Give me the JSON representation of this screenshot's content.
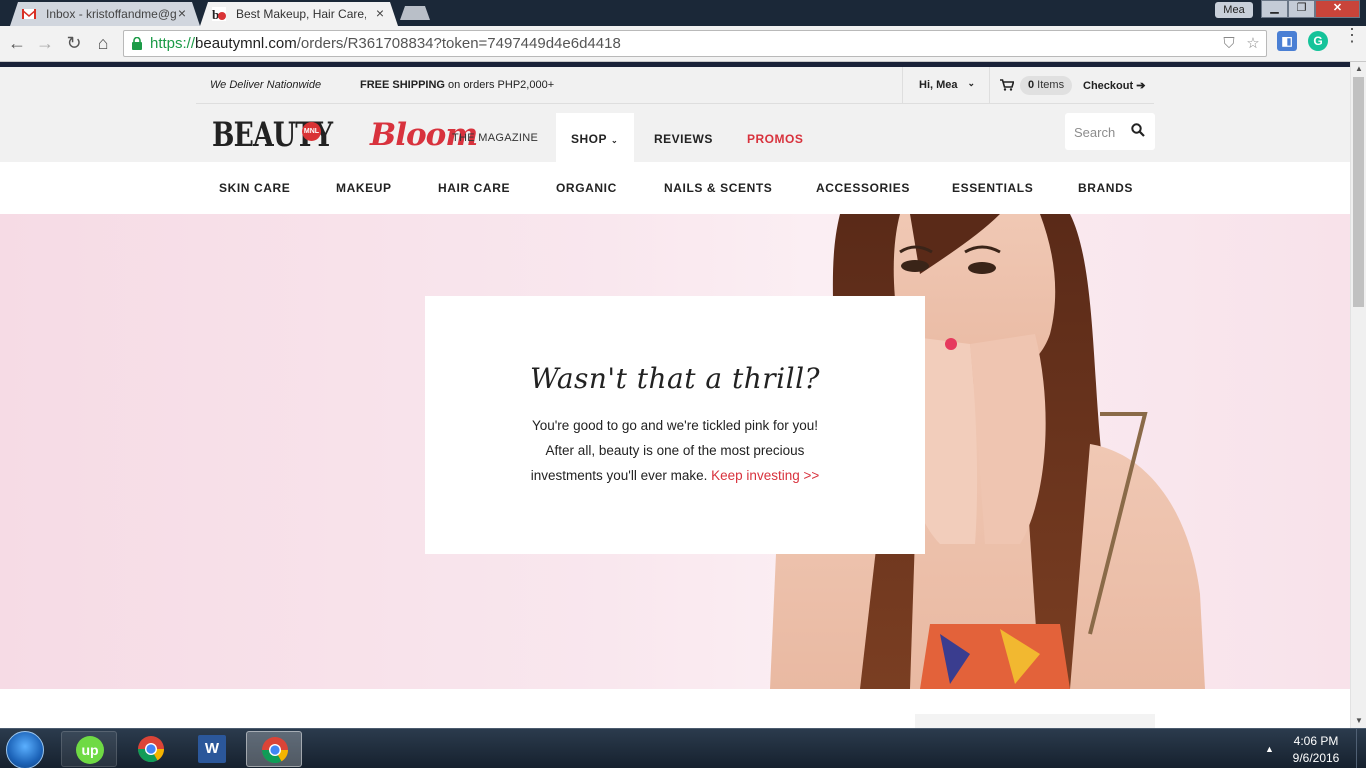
{
  "browser": {
    "tabs": [
      {
        "title": "Inbox - kristoffandme@gr",
        "active": false,
        "icon": "gmail-icon"
      },
      {
        "title": "Best Makeup, Hair Care, S",
        "active": true,
        "icon": "beautymnl-favicon"
      }
    ],
    "profile_name": "Mea",
    "url_scheme": "https://",
    "url_host": "beautymnl.com",
    "url_path": "/orders/R361708834?token=7497449d4e6d4418"
  },
  "site": {
    "topbar": {
      "deliver": "We Deliver Nationwide",
      "free_shipping_bold": "FREE SHIPPING",
      "free_shipping_rest": " on orders PHP2,000+",
      "greeting": "Hi, Mea",
      "cart_count": "0",
      "cart_unit": " Items",
      "checkout": "Checkout"
    },
    "logo": {
      "word": "BEAUTY",
      "badge": "MNL"
    },
    "magazine": {
      "name": "Bloom",
      "subtitle": "THE MAGAZINE"
    },
    "main_nav": [
      {
        "label": "SHOP"
      },
      {
        "label": "REVIEWS"
      },
      {
        "label": "PROMOS"
      }
    ],
    "search_placeholder": "Search",
    "categories": [
      "SKIN CARE",
      "MAKEUP",
      "HAIR CARE",
      "ORGANIC",
      "NAILS & SCENTS",
      "ACCESSORIES",
      "ESSENTIALS",
      "BRANDS"
    ]
  },
  "hero": {
    "title": "Wasn't that a thrill?",
    "line1": "You're good to go and we're tickled pink for you!",
    "line2": "After all, beauty is one of the most precious",
    "line3": "investments you'll ever make. ",
    "link": "Keep investing >>"
  },
  "taskbar": {
    "time": "4:06 PM",
    "date": "9/6/2016",
    "apps": [
      "upwork-icon",
      "chrome-icon",
      "word-icon",
      "chrome-icon"
    ]
  },
  "colors": {
    "brand_red": "#d8323d",
    "hero_pink": "#f6dbe5",
    "url_green": "#1c9b47"
  }
}
